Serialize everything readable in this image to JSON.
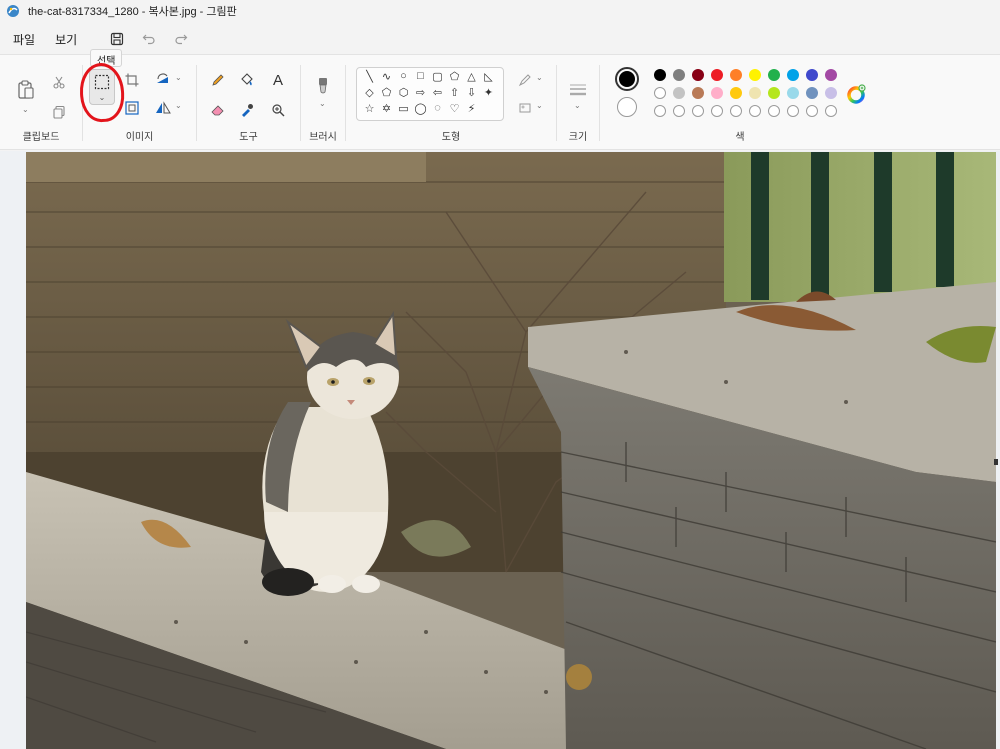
{
  "window": {
    "title": "the-cat-8317334_1280 - 복사본.jpg - 그림판"
  },
  "menu": {
    "file": "파일",
    "view": "보기"
  },
  "tooltip": {
    "text": "선택"
  },
  "ribbon": {
    "groups": {
      "clipboard": "클립보드",
      "image": "이미지",
      "tools": "도구",
      "brush": "브러시",
      "shapes": "도형",
      "size": "크기",
      "colors": "색"
    }
  },
  "colors": {
    "current_primary": "#000000",
    "current_secondary": "#ffffff",
    "palette_row1": [
      "#000000",
      "#7f7f7f",
      "#880015",
      "#ed1c24",
      "#ff7f27",
      "#fff200",
      "#22b14c",
      "#00a2e8",
      "#3f48cc",
      "#a349a4"
    ],
    "palette_row2": [
      "#ffffff",
      "#c3c3c3",
      "#b97a57",
      "#ffaec9",
      "#ffc90e",
      "#efe4b0",
      "#b5e61d",
      "#99d9ea",
      "#7092be",
      "#c8bfe7"
    ],
    "annotation": "#e3141b"
  },
  "shapes": [
    "╲",
    "∿",
    "○",
    "□",
    "▢",
    "⬠",
    "△",
    "◺",
    "◇",
    "⬠",
    "⬡",
    "⇨",
    "⇦",
    "⇧",
    "⇩",
    "✦",
    "☆",
    "✡",
    "▭",
    "◯",
    "◌",
    "♡",
    "⚡",
    ""
  ],
  "canvas": {
    "image_description_icon": "photo-canvas"
  }
}
